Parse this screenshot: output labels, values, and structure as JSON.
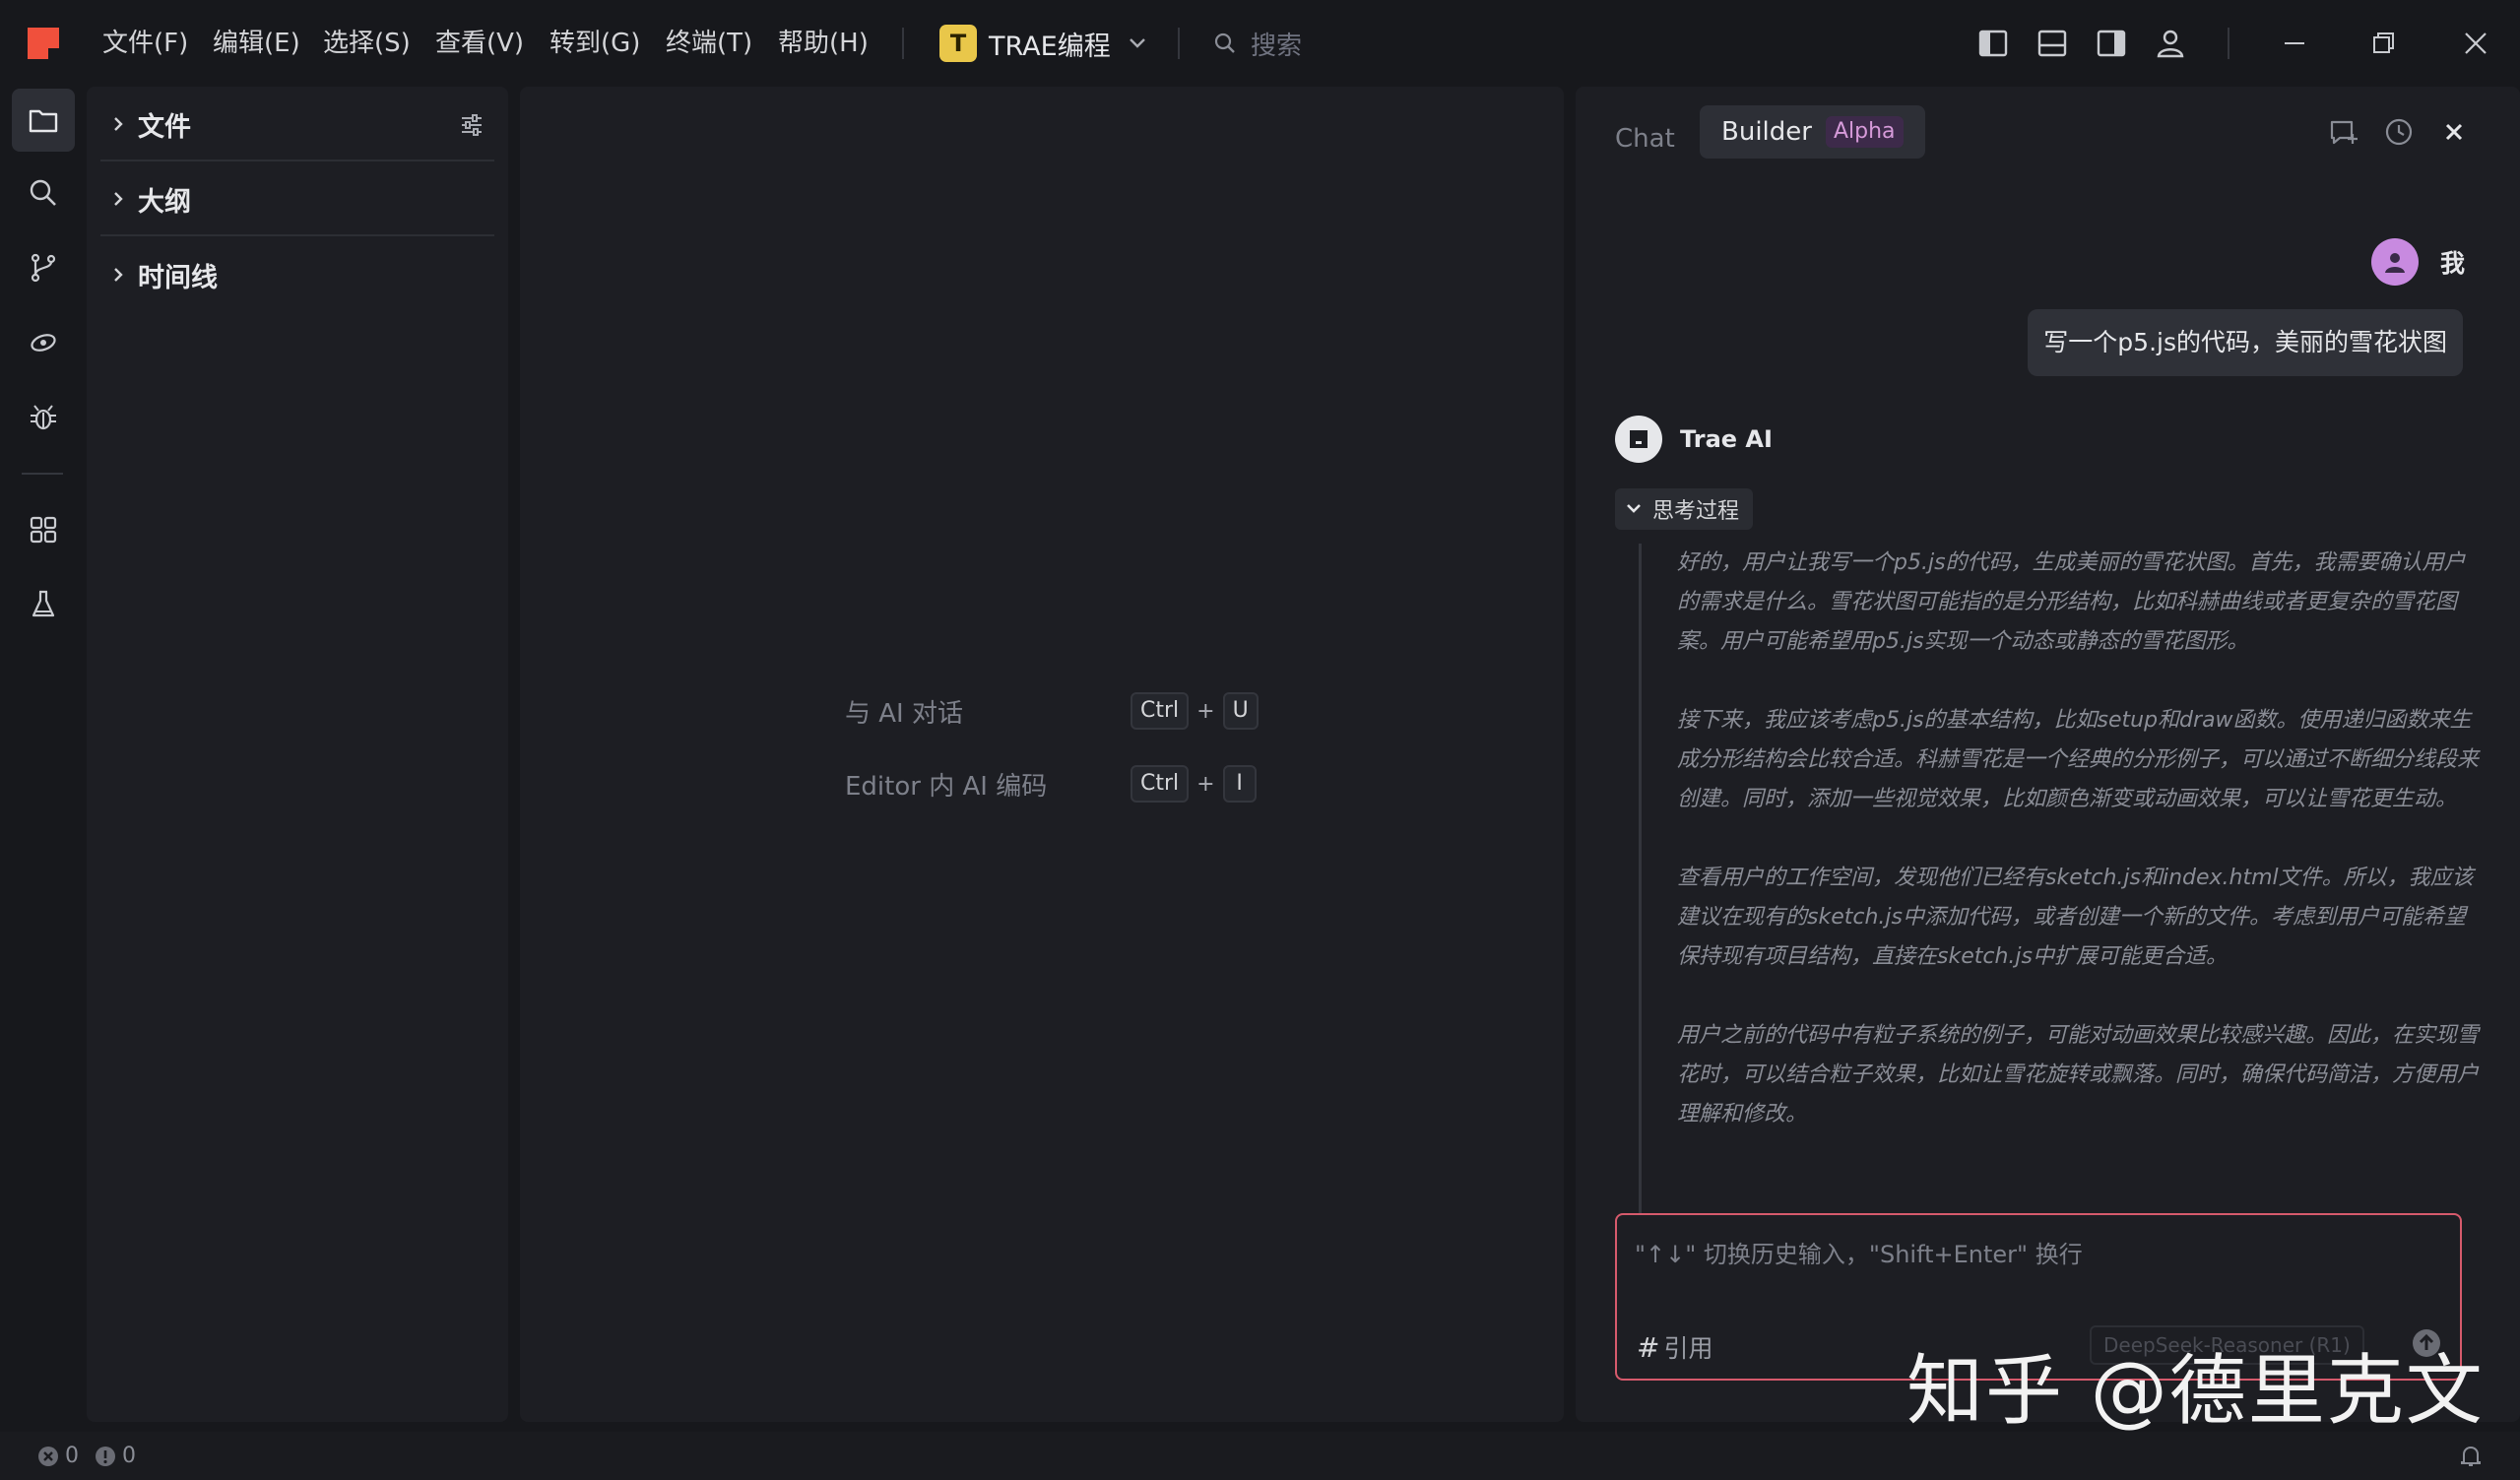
{
  "menubar": {
    "items": [
      "文件(F)",
      "编辑(E)",
      "选择(S)",
      "查看(V)",
      "转到(G)",
      "终端(T)",
      "帮助(H)"
    ],
    "project_initial": "T",
    "project_name": "TRAE编程",
    "search_placeholder": "搜索"
  },
  "activity_bar": {
    "icons": [
      "folder-icon",
      "search-icon",
      "source-control-icon",
      "ai-eye-icon",
      "debug-icon",
      "extensions-icon",
      "flask-icon"
    ],
    "active": "folder-icon"
  },
  "explorer": {
    "sections": [
      {
        "title": "文件"
      },
      {
        "title": "大纲"
      },
      {
        "title": "时间线"
      }
    ]
  },
  "editor": {
    "hints": [
      {
        "label": "与 AI 对话",
        "keys": [
          "Ctrl",
          "U"
        ]
      },
      {
        "label": "Editor 内 AI 编码",
        "keys": [
          "Ctrl",
          "I"
        ]
      }
    ],
    "plus": "+"
  },
  "ai_panel": {
    "tabs": {
      "chat": "Chat",
      "builder": "Builder",
      "builder_badge": "Alpha",
      "active": "Builder"
    },
    "user": {
      "name": "我",
      "message": "写一个p5.js的代码，美丽的雪花状图"
    },
    "assistant": {
      "name": "Trae AI",
      "thinking_label": "思考过程",
      "thinking": [
        "好的，用户让我写一个p5.js的代码，生成美丽的雪花状图。首先，我需要确认用户的需求是什么。雪花状图可能指的是分形结构，比如科赫曲线或者更复杂的雪花图案。用户可能希望用p5.js实现一个动态或静态的雪花图形。",
        "接下来，我应该考虑p5.js的基本结构，比如setup和draw函数。使用递归函数来生成分形结构会比较合适。科赫雪花是一个经典的分形例子，可以通过不断细分线段来创建。同时，添加一些视觉效果，比如颜色渐变或动画效果，可以让雪花更生动。",
        "查看用户的工作空间，发现他们已经有sketch.js和index.html文件。所以，我应该建议在现有的sketch.js中添加代码，或者创建一个新的文件。考虑到用户可能希望保持现有项目结构，直接在sketch.js中扩展可能更合适。",
        "用户之前的代码中有粒子系统的例子，可能对动画效果比较感兴趣。因此，在实现雪花时，可以结合粒子效果，比如让雪花旋转或飘落。同时，确保代码简洁，方便用户理解和修改。"
      ]
    },
    "input": {
      "placeholder": "\"↑↓\" 切换历史输入，\"Shift+Enter\" 换行",
      "reference_hash": "#",
      "reference_label": "引用",
      "model": "DeepSeek-Reasoner (R1)"
    }
  },
  "watermark": "知乎 @德里克文",
  "statusbar": {
    "errors": "0",
    "warnings": "0"
  },
  "colors": {
    "background": "#17181c",
    "panel": "#1d1e23",
    "accent_logo": "#f0503c",
    "project_badge": "#e9c74a",
    "alpha_badge": "#d69ad9",
    "input_border": "#d65a6c",
    "user_avatar": "#c88ae0"
  }
}
